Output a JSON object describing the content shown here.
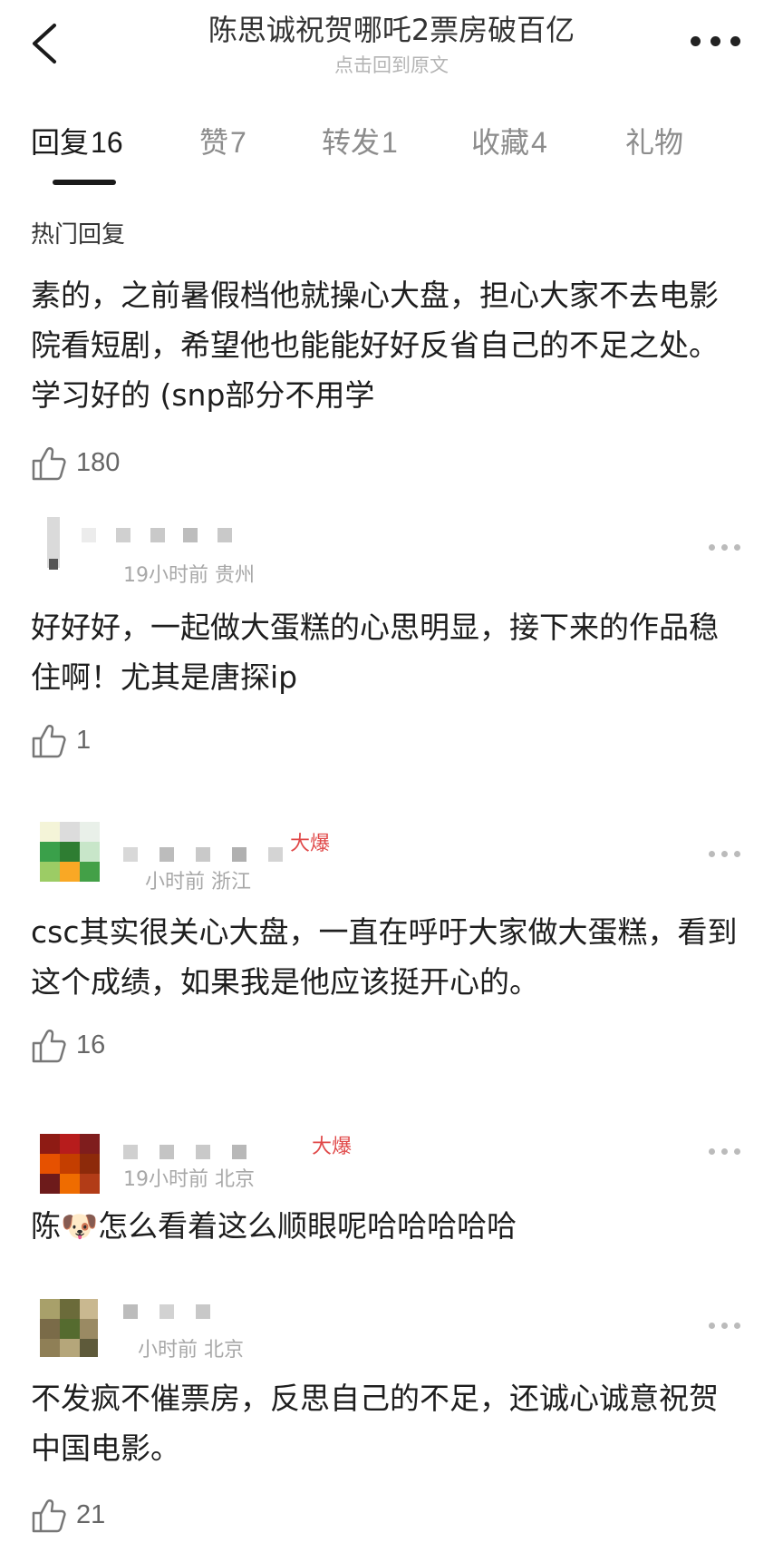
{
  "header": {
    "title": "陈思诚祝贺哪吒2票房破百亿",
    "subtitle": "点击回到原文"
  },
  "tabs": [
    {
      "label": "回复",
      "count": "16",
      "active": true
    },
    {
      "label": "赞",
      "count": "7",
      "active": false
    },
    {
      "label": "转发",
      "count": "1",
      "active": false
    },
    {
      "label": "收藏",
      "count": "4",
      "active": false
    },
    {
      "label": "礼物",
      "count": "",
      "active": false
    }
  ],
  "section_label": "热门回复",
  "comments": [
    {
      "text": "素的，之前暑假档他就操心大盘，担心大家不去电影院看短剧，希望他也能能好好反省自己的不足之处。学习好的 (snp部分不用学",
      "likes": "180"
    },
    {
      "meta": "19小时前 贵州",
      "text": "好好好，一起做大蛋糕的心思明显，接下来的作品稳住啊！尤其是唐探ip",
      "likes": "1"
    },
    {
      "badge": "大爆",
      "meta": "小时前 浙江",
      "text": "csc其实很关心大盘，一直在呼吁大家做大蛋糕，看到这个成绩，如果我是他应该挺开心的。",
      "likes": "16"
    },
    {
      "badge": "大爆",
      "meta": "19小时前 北京",
      "text_before": "陈",
      "emoji": "🐶",
      "text_after": "怎么看着这么顺眼呢哈哈哈哈哈"
    },
    {
      "meta": "小时前 北京",
      "text": "不发疯不催票房，反思自己的不足，还诚心诚意祝贺中国电影。",
      "likes": "21"
    }
  ]
}
